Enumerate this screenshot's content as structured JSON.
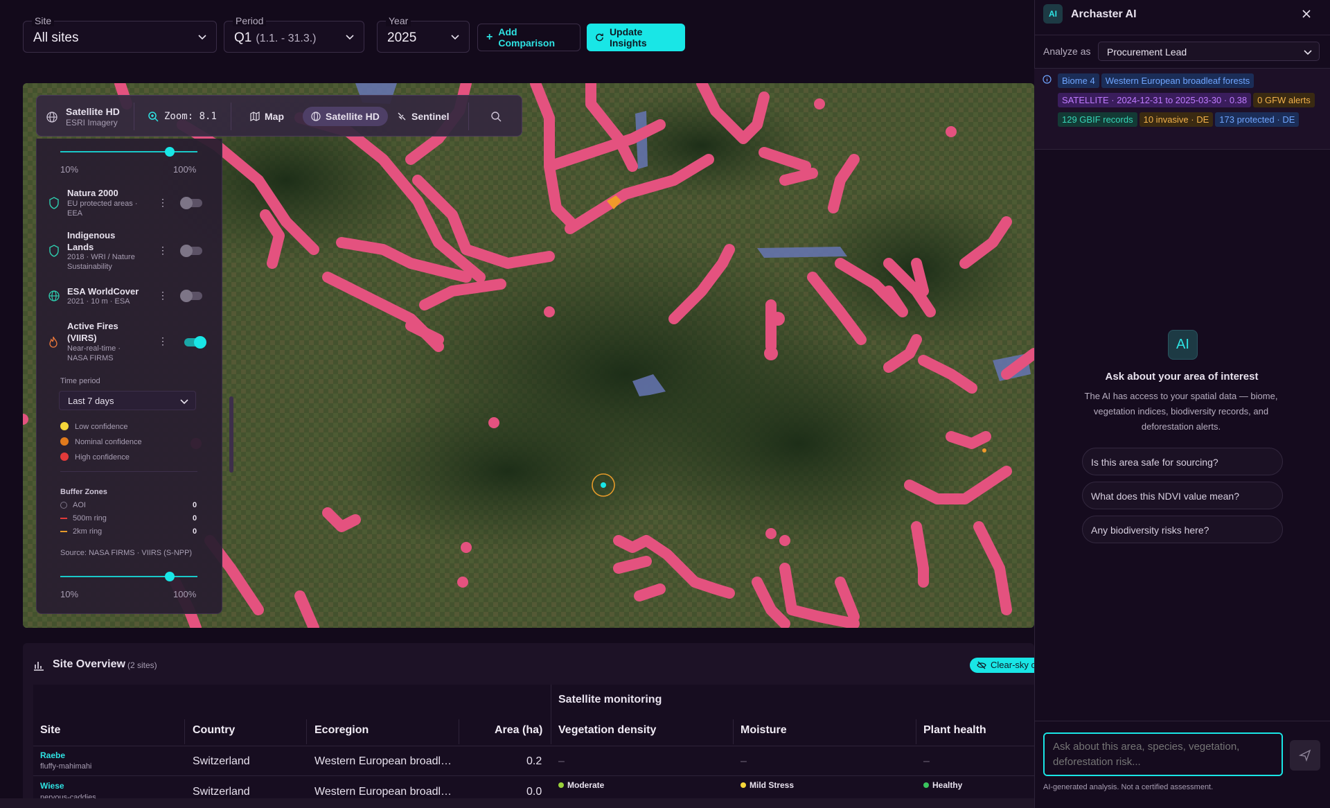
{
  "filters": {
    "site": {
      "label": "Site",
      "value": "All sites"
    },
    "period": {
      "label": "Period",
      "value": "Q1",
      "range": "(1.1. - 31.3.)"
    },
    "year": {
      "label": "Year",
      "value": "2025"
    },
    "add_comparison": "Add Comparison",
    "update_insights": "Update Insights"
  },
  "map_toolbar": {
    "source_title": "Satellite HD",
    "source_sub": "ESRI Imagery",
    "zoom_label": "Zoom:",
    "zoom_value": "8.1",
    "modes": [
      "Map",
      "Satellite HD",
      "Sentinel"
    ],
    "active_mode": "Satellite HD"
  },
  "layers": {
    "top_slider": {
      "min": "10%",
      "max": "100%",
      "value": 0.8
    },
    "items": [
      {
        "title": "Natura 2000",
        "sub": "EU protected areas · EEA",
        "icon": "shield-icon",
        "on": false
      },
      {
        "title": "Indigenous Lands",
        "sub": "2018 · WRI / Nature Sustainability",
        "icon": "shield-icon",
        "on": false
      },
      {
        "title": "ESA WorldCover",
        "sub": "2021 · 10 m · ESA",
        "icon": "globe-icon",
        "on": false
      },
      {
        "title": "Active Fires (VIIRS)",
        "sub": "Near-real-time · NASA FIRMS",
        "icon": "flame-icon",
        "on": true
      }
    ],
    "time_period_label": "Time period",
    "time_period_value": "Last 7 days",
    "confidence": [
      {
        "label": "Low confidence",
        "color": "#f5d63a"
      },
      {
        "label": "Nominal confidence",
        "color": "#e07a1c"
      },
      {
        "label": "High confidence",
        "color": "#e23a3a"
      }
    ],
    "buffer_title": "Buffer Zones",
    "buffers": [
      {
        "label": "AOI",
        "count": "0",
        "color": "#7d7587"
      },
      {
        "label": "500m ring",
        "count": "0",
        "color": "#e23a3a"
      },
      {
        "label": "2km ring",
        "count": "0",
        "color": "#e59a2a"
      }
    ],
    "source": "Source: NASA FIRMS · VIIRS (S-NPP)",
    "bottom_slider": {
      "min": "10%",
      "max": "100%",
      "value": 0.8
    }
  },
  "overview": {
    "title": "Site Overview",
    "count": "(2 sites)",
    "clear_sky": "Clear-sky o",
    "group_header": "Satellite monitoring",
    "columns": [
      "Site",
      "Country",
      "Ecoregion",
      "Area (ha)",
      "Vegetation density",
      "Moisture",
      "Plant health"
    ],
    "rows": [
      {
        "site": "Raebe",
        "slug": "fluffy-mahimahi",
        "country": "Switzerland",
        "ecoregion": "Western European broadl…",
        "area": "0.2",
        "veg": "–",
        "moist": "–",
        "health": "–"
      },
      {
        "site": "Wiese",
        "slug": "nervous-caddies",
        "country": "Switzerland",
        "ecoregion": "Western European broadl…",
        "area": "0.0",
        "veg": "Moderate",
        "veg_color": "#9ad13a",
        "moist": "Mild Stress",
        "moist_color": "#f5d63a",
        "health": "Healthy",
        "health_color": "#3ac45e"
      }
    ]
  },
  "ai": {
    "badge": "AI",
    "title": "Archaster AI",
    "analyze_label": "Analyze as",
    "analyze_value": "Procurement Lead",
    "chips": [
      {
        "text": "Biome 4",
        "bg": "#1b2d57",
        "fg": "#6fa5ff"
      },
      {
        "text": "Western European broadleaf forests",
        "bg": "#1b2d57",
        "fg": "#6fa5ff"
      },
      {
        "text": "SATELLITE · 2024-12-31 to 2025-03-30 · 0.38",
        "bg": "#3a1d5c",
        "fg": "#c07bff"
      },
      {
        "text": "0 GFW alerts",
        "bg": "#3a2a12",
        "fg": "#f3b24a"
      },
      {
        "text": "129 GBIF records",
        "bg": "#133a35",
        "fg": "#38d6b8"
      },
      {
        "text": "10 invasive · DE",
        "bg": "#3a2a12",
        "fg": "#f3b24a"
      },
      {
        "text": "173 protected · DE",
        "bg": "#1b2d57",
        "fg": "#6fa5ff"
      }
    ],
    "empty_badge": "AI",
    "empty_title": "Ask about your area of interest",
    "empty_text": "The AI has access to your spatial data — biome, vegetation indices, biodiversity records, and deforestation alerts.",
    "suggestions": [
      "Is this area safe for sourcing?",
      "What does this NDVI value mean?",
      "Any biodiversity risks here?"
    ],
    "input_placeholder": "Ask about this area, species, vegetation, deforestation risk...",
    "disclaimer": "AI-generated analysis. Not a certified assessment."
  }
}
